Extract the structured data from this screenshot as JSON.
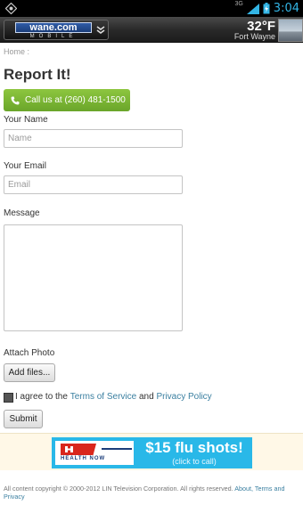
{
  "status_bar": {
    "time": "3:04",
    "network": "3G"
  },
  "header": {
    "logo_main": "wane.com",
    "logo_sub": "MOBILE",
    "temperature": "32°F",
    "city": "Fort Wayne"
  },
  "breadcrumb": "Home :",
  "page_title": "Report It!",
  "call_button": "Call us at (260) 481-1500",
  "form": {
    "name_label": "Your Name",
    "name_placeholder": "Name",
    "email_label": "Your Email",
    "email_placeholder": "Email",
    "message_label": "Message",
    "attach_label": "Attach Photo",
    "add_files": "Add files...",
    "agree_prefix": "I agree to the ",
    "terms_link": "Terms of Service",
    "agree_and": " and ",
    "privacy_link": "Privacy Policy",
    "submit": "Submit"
  },
  "ad": {
    "logo_sub": "HEALTH NOW",
    "headline": "$15 flu shots!",
    "subline": "(click to call)"
  },
  "footer": {
    "text": "All content copyright © 2000-2012 LIN Television Corporation. All rights reserved. ",
    "about_link": "About,",
    "terms_link": "Terms and Privacy"
  },
  "colors": {
    "accent_green": "#7ab535",
    "link": "#3a7fa0",
    "ad_blue": "#29b8e8",
    "time_blue": "#33b5e5"
  }
}
